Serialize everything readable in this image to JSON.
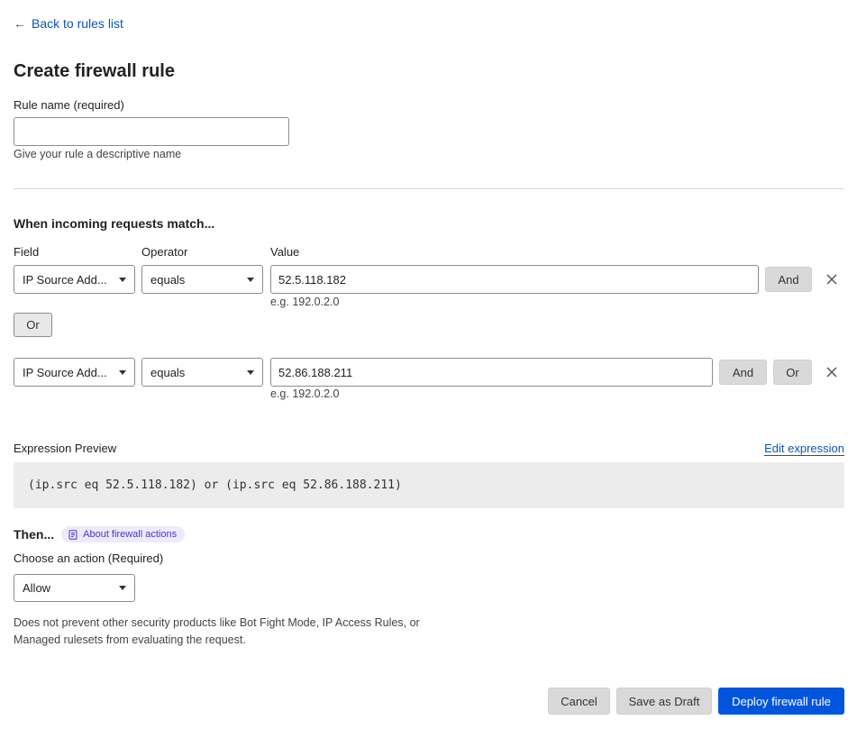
{
  "nav": {
    "back_label": "Back to rules list"
  },
  "page": {
    "title": "Create firewall rule"
  },
  "rule_name": {
    "label": "Rule name (required)",
    "value": "",
    "placeholder": "",
    "hint": "Give your rule a descriptive name"
  },
  "match": {
    "title": "When incoming requests match...",
    "headers": {
      "field": "Field",
      "operator": "Operator",
      "value": "Value"
    },
    "rows": [
      {
        "field": "IP Source Add...",
        "operator": "equals",
        "value": "52.5.118.182",
        "hint": "e.g. 192.0.2.0"
      },
      {
        "field": "IP Source Add...",
        "operator": "equals",
        "value": "52.86.188.211",
        "hint": "e.g. 192.0.2.0"
      }
    ],
    "and_label": "And",
    "or_label": "Or"
  },
  "preview": {
    "label": "Expression Preview",
    "edit_label": "Edit expression",
    "expression": "(ip.src eq 52.5.118.182) or (ip.src eq 52.86.188.211)"
  },
  "then": {
    "title": "Then...",
    "about_label": "About firewall actions",
    "action_label": "Choose an action (Required)",
    "action_value": "Allow",
    "description": "Does not prevent other security products like Bot Fight Mode, IP Access Rules, or Managed rulesets from evaluating the request."
  },
  "footer": {
    "cancel_label": "Cancel",
    "draft_label": "Save as Draft",
    "deploy_label": "Deploy firewall rule"
  },
  "colors": {
    "link": "#0a55b6",
    "primary": "#0055dc",
    "pill_bg": "#eeeafd",
    "pill_text": "#4a35b5"
  },
  "icons": {
    "back": "arrow-left-icon",
    "remove": "close-icon",
    "docs": "document-icon",
    "dropdown": "caret-down-icon"
  }
}
